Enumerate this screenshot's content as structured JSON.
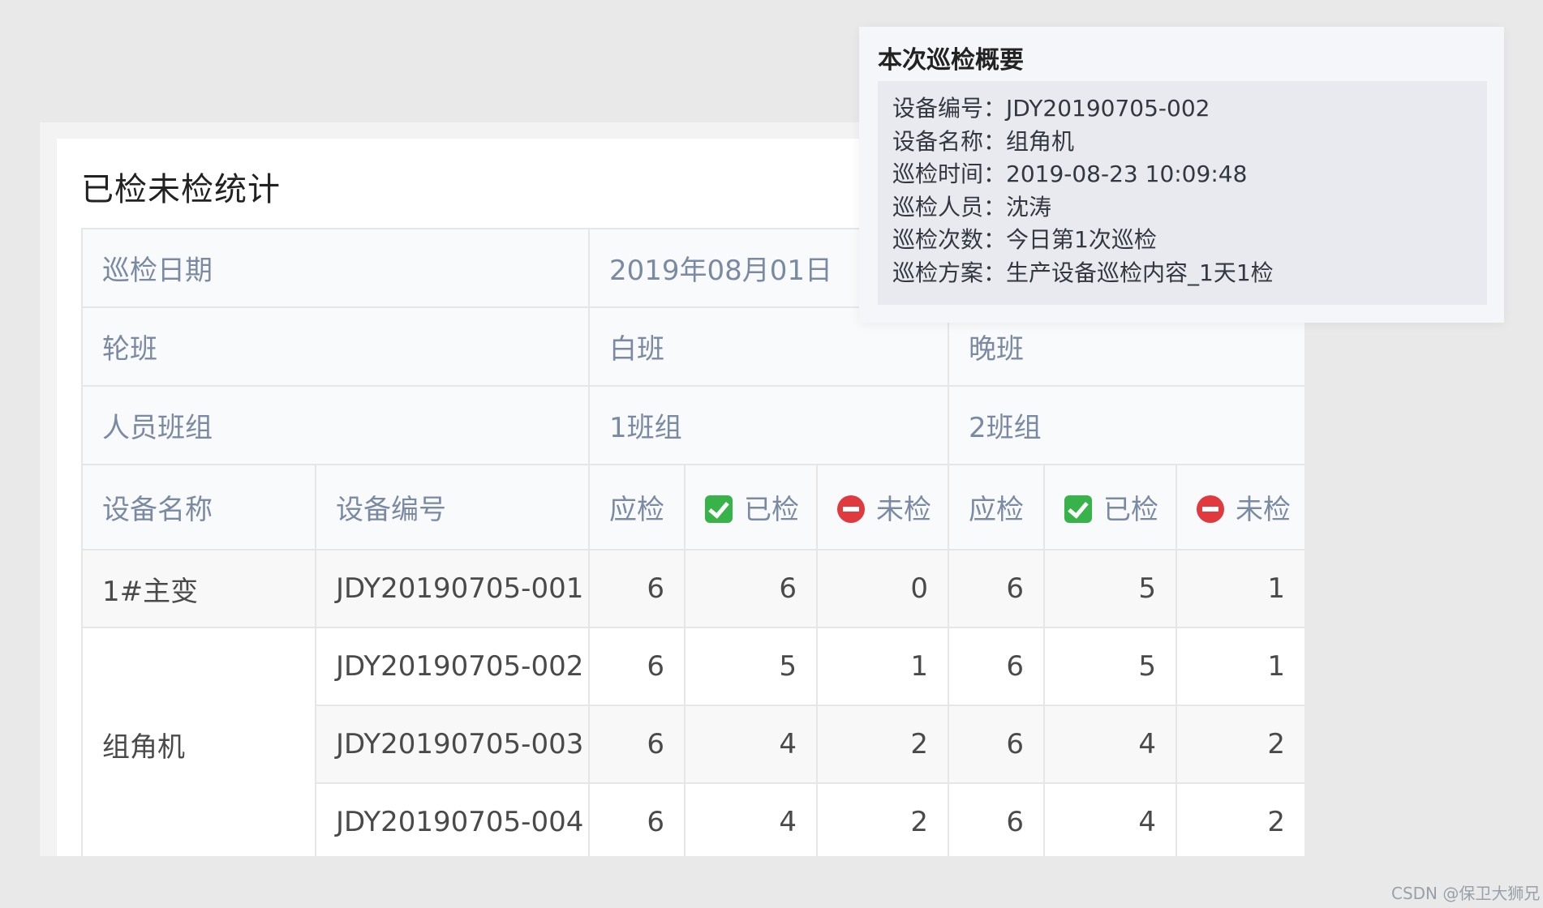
{
  "card": {
    "title": "已检未检统计"
  },
  "table": {
    "inspection_date_label": "巡检日期",
    "inspection_date_value": "2019年08月01日",
    "shift_label": "轮班",
    "shift_day": "白班",
    "shift_night": "晚班",
    "team_label": "人员班组",
    "team_day": "1班组",
    "team_night": "2班组",
    "col_device_name": "设备名称",
    "col_device_code": "设备编号",
    "col_should": "应检",
    "col_checked": "已检",
    "col_unchecked": "未检",
    "checked_icon": "check-mark-icon",
    "unchecked_icon": "no-entry-icon",
    "groups": [
      {
        "device_name": "1#主变",
        "rows": [
          {
            "code": "JDY20190705-001",
            "day": [
              6,
              6,
              0
            ],
            "night": [
              6,
              5,
              1
            ]
          }
        ]
      },
      {
        "device_name": "组角机",
        "rows": [
          {
            "code": "JDY20190705-002",
            "day": [
              6,
              5,
              1
            ],
            "night": [
              6,
              5,
              1
            ]
          },
          {
            "code": "JDY20190705-003",
            "day": [
              6,
              4,
              2
            ],
            "night": [
              6,
              4,
              2
            ]
          },
          {
            "code": "JDY20190705-004",
            "day": [
              6,
              4,
              2
            ],
            "night": [
              6,
              4,
              2
            ]
          }
        ]
      }
    ]
  },
  "popover": {
    "title": "本次巡检概要",
    "lines": [
      "设备编号：JDY20190705-002",
      "设备名称：组角机",
      "巡检时间：2019-08-23 10:09:48",
      "巡检人员：沈涛",
      "巡检次数：今日第1次巡检",
      "巡检方案：生产设备巡检内容_1天1检"
    ]
  },
  "watermark": "CSDN @保卫大狮兄",
  "colors": {
    "header_text": "#7a8aa3",
    "checked": "#38b34a",
    "unchecked": "#e0393e"
  }
}
